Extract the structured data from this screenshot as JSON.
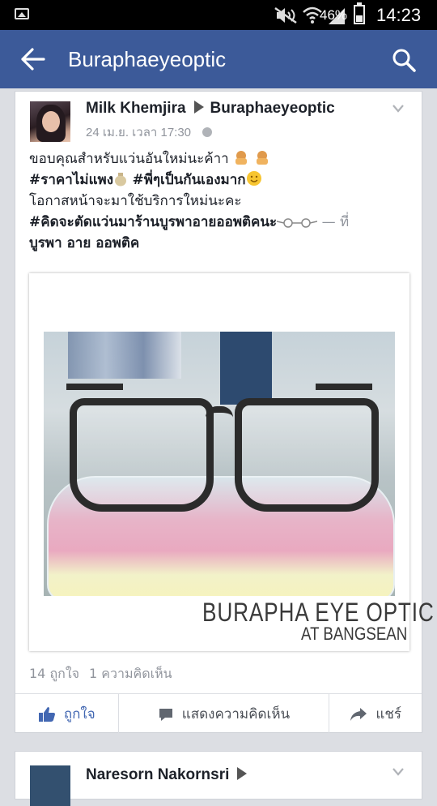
{
  "status_bar": {
    "battery_pct": "46%",
    "battery_level": 0.46,
    "time": "14:23",
    "icons": [
      "image-notification-icon",
      "mute-icon",
      "wifi-icon",
      "signal-icon",
      "battery-icon"
    ]
  },
  "app_bar": {
    "title": "Buraphaeyeoptic",
    "color": "#3c5a99"
  },
  "post": {
    "author": "Milk Khemjira",
    "target": "Buraphaeyeoptic",
    "timestamp": "24 เม.ย. เวลา 17:30",
    "text": {
      "line1": "ขอบคุณสำหรับแว่นอันใหม่นะค้าา",
      "line2_tag1": "#ราคาไม่แพง",
      "line2_tag2": "#พี่ๆเป็นกันเองมาก",
      "line3": "โอกาสหน้าจะมาใช้บริการใหม่นะคะ",
      "line4_tag": "#คิดจะตัดแว่นมาร้านบูรพาอายออพติคนะ",
      "line4_suffix": " — ที่",
      "location": "บูรพา อาย ออพติค"
    },
    "image_caption_line1": "BURAPHA EYE OPTIC",
    "image_caption_line2": "AT BANGSEAN",
    "likes": "14 ถูกใจ",
    "comments": "1 ความคิดเห็น",
    "actions": {
      "like": "ถูกใจ",
      "comment": "แสดงความคิดเห็น",
      "share": "แชร์"
    }
  },
  "next_post": {
    "author": "Naresorn Nakornsri"
  }
}
